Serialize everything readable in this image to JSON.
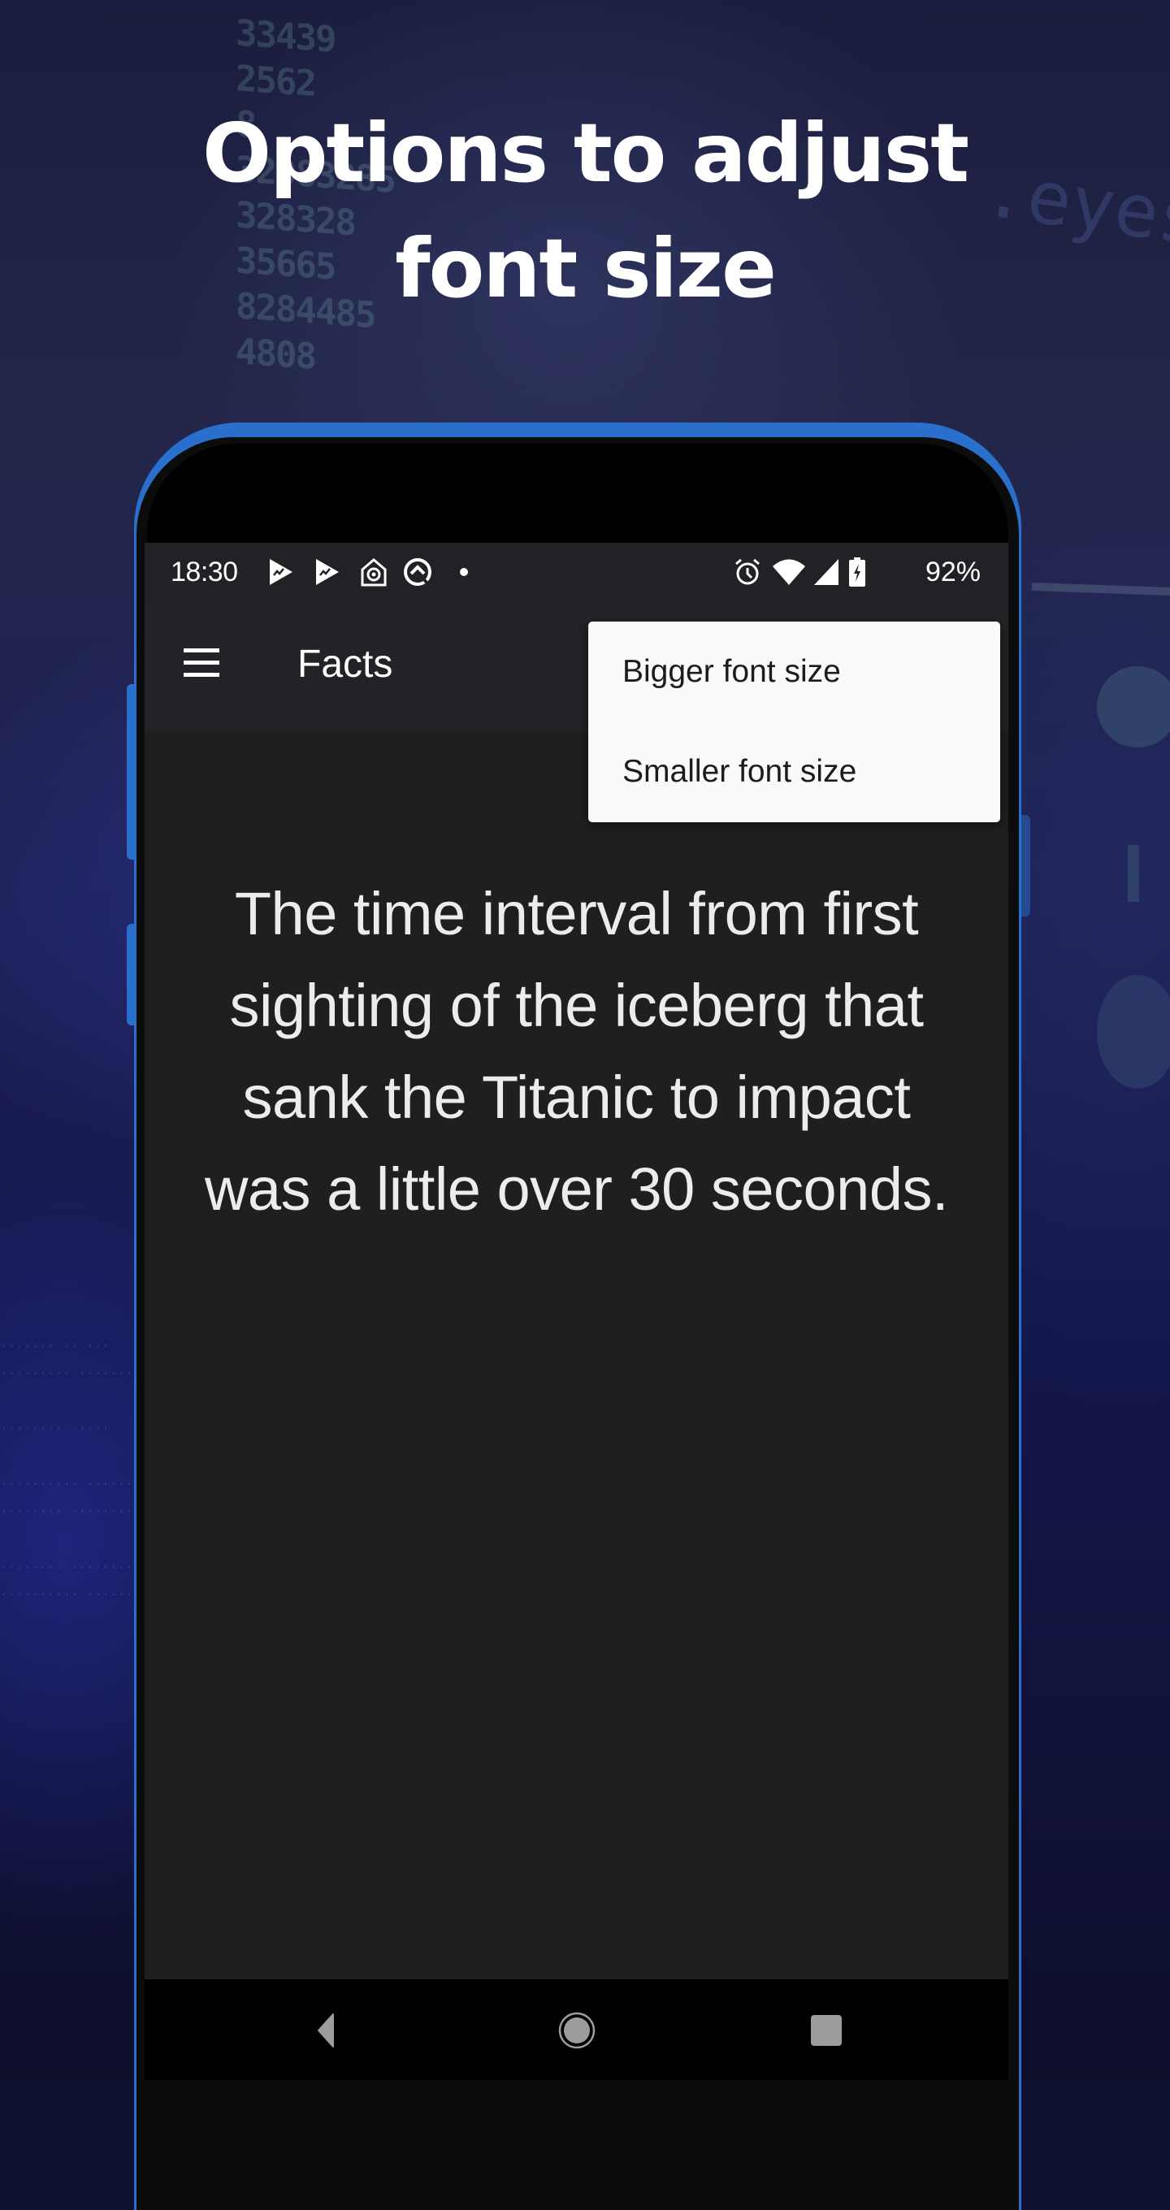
{
  "promo": {
    "headline_line1": "Options to adjust",
    "headline_line2": "font size"
  },
  "status_bar": {
    "time": "18:30",
    "left_icons": [
      "play-store-icon",
      "play-store-icon",
      "home-camera-icon",
      "q-circle-icon",
      "notification-dot-icon"
    ],
    "right_icons": [
      "alarm-icon",
      "wifi-icon",
      "cell-signal-icon",
      "battery-charging-icon"
    ],
    "battery": "92%"
  },
  "app_bar": {
    "menu_icon": "hamburger-menu-icon",
    "title": "Facts"
  },
  "overflow_menu": {
    "items": [
      {
        "label": "Bigger font size"
      },
      {
        "label": "Smaller font size"
      }
    ]
  },
  "content": {
    "fact": "The time interval from first sighting of the iceberg that sank the Titanic to impact was a little over 30 seconds."
  },
  "nav_bar": {
    "back": "back-icon",
    "home": "home-icon",
    "recents": "recents-icon"
  },
  "colors": {
    "phone_accent": "#2a6fcc",
    "app_bar": "#222326",
    "content_bg": "#1f1f1f",
    "menu_bg": "#fafafa"
  }
}
